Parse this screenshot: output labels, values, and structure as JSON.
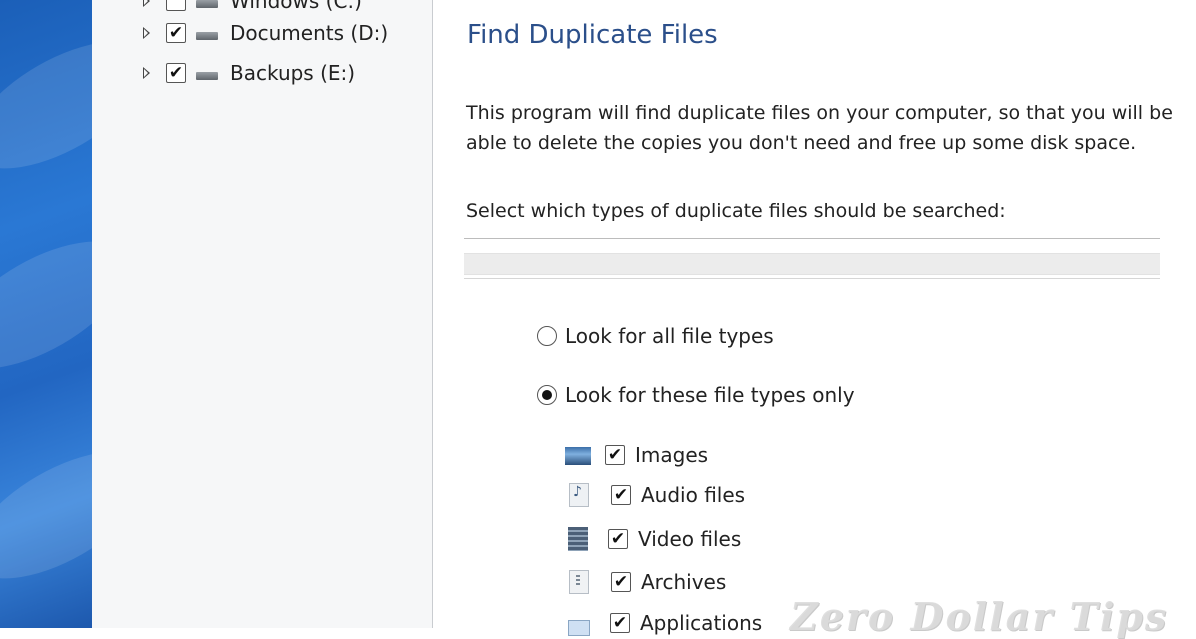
{
  "tree": {
    "items": [
      {
        "label": "Windows (C:)",
        "checked": true
      },
      {
        "label": "Documents (D:)",
        "checked": true
      },
      {
        "label": "Backups (E:)",
        "checked": true
      }
    ]
  },
  "content": {
    "title": "Find Duplicate Files",
    "description": "This program will find duplicate files on your computer, so that you will be able to delete the copies you don't need and free up some disk space.",
    "select_label": "Select which types of duplicate files should be searched:",
    "options": {
      "all_types": {
        "label": "Look for all file types",
        "selected": false
      },
      "these_types": {
        "label": "Look for these file types only",
        "selected": true
      }
    },
    "file_types": [
      {
        "label": "Images",
        "icon": "image-icon",
        "checked": true
      },
      {
        "label": "Audio files",
        "icon": "audio-file-icon",
        "checked": true
      },
      {
        "label": "Video files",
        "icon": "video-file-icon",
        "checked": true
      },
      {
        "label": "Archives",
        "icon": "archive-icon",
        "checked": true
      },
      {
        "label": "Applications",
        "icon": "application-icon",
        "checked": true
      }
    ],
    "check_glyph": "✔"
  },
  "watermark": "Zero Dollar Tips"
}
